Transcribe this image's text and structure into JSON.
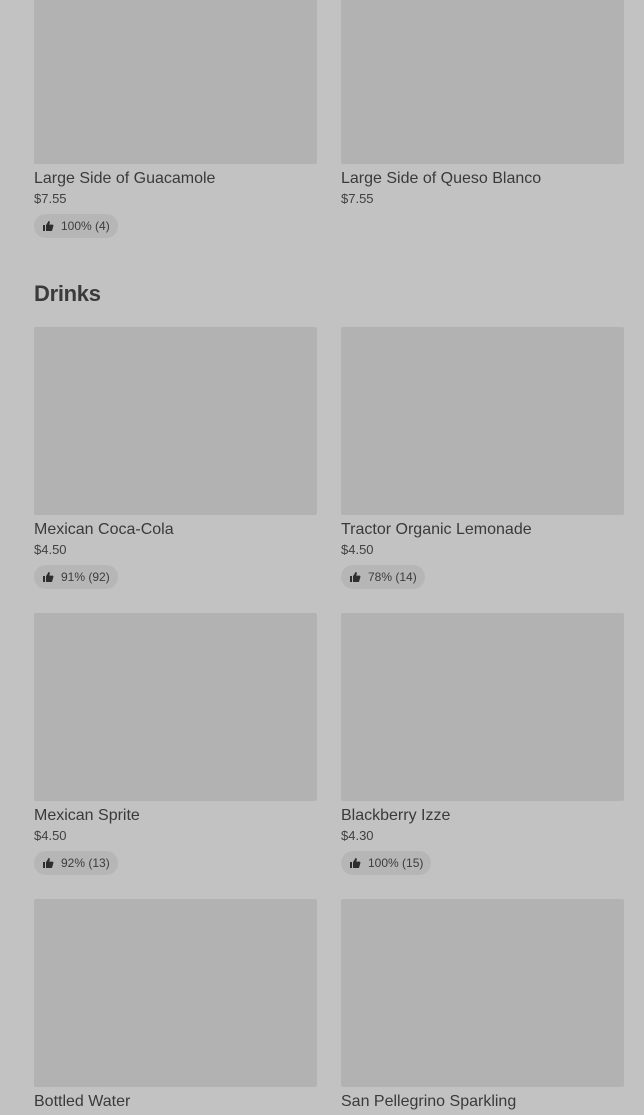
{
  "sides": [
    {
      "title": "Large Side of Guacamole",
      "price": "$7.55",
      "rating": "100% (4)"
    },
    {
      "title": "Large Side of Queso Blanco",
      "price": "$7.55",
      "rating": null
    }
  ],
  "drinks_section": {
    "title": "Drinks",
    "items": [
      {
        "title": "Mexican Coca-Cola",
        "price": "$4.50",
        "rating": "91% (92)"
      },
      {
        "title": "Tractor Organic Lemonade",
        "price": "$4.50",
        "rating": "78% (14)"
      },
      {
        "title": "Mexican Sprite",
        "price": "$4.50",
        "rating": "92% (13)"
      },
      {
        "title": "Blackberry Izze",
        "price": "$4.30",
        "rating": "100% (15)"
      },
      {
        "title": "Bottled Water",
        "price": "",
        "rating": null
      },
      {
        "title": "San Pellegrino Sparkling",
        "price": "",
        "rating": null
      }
    ]
  },
  "icons": {
    "rating": "thumbs-up-icon"
  },
  "colors": {
    "background": "#c2c2c2",
    "image_placeholder": "#b2b2b2",
    "rating_pill": "#b6b6b6"
  }
}
